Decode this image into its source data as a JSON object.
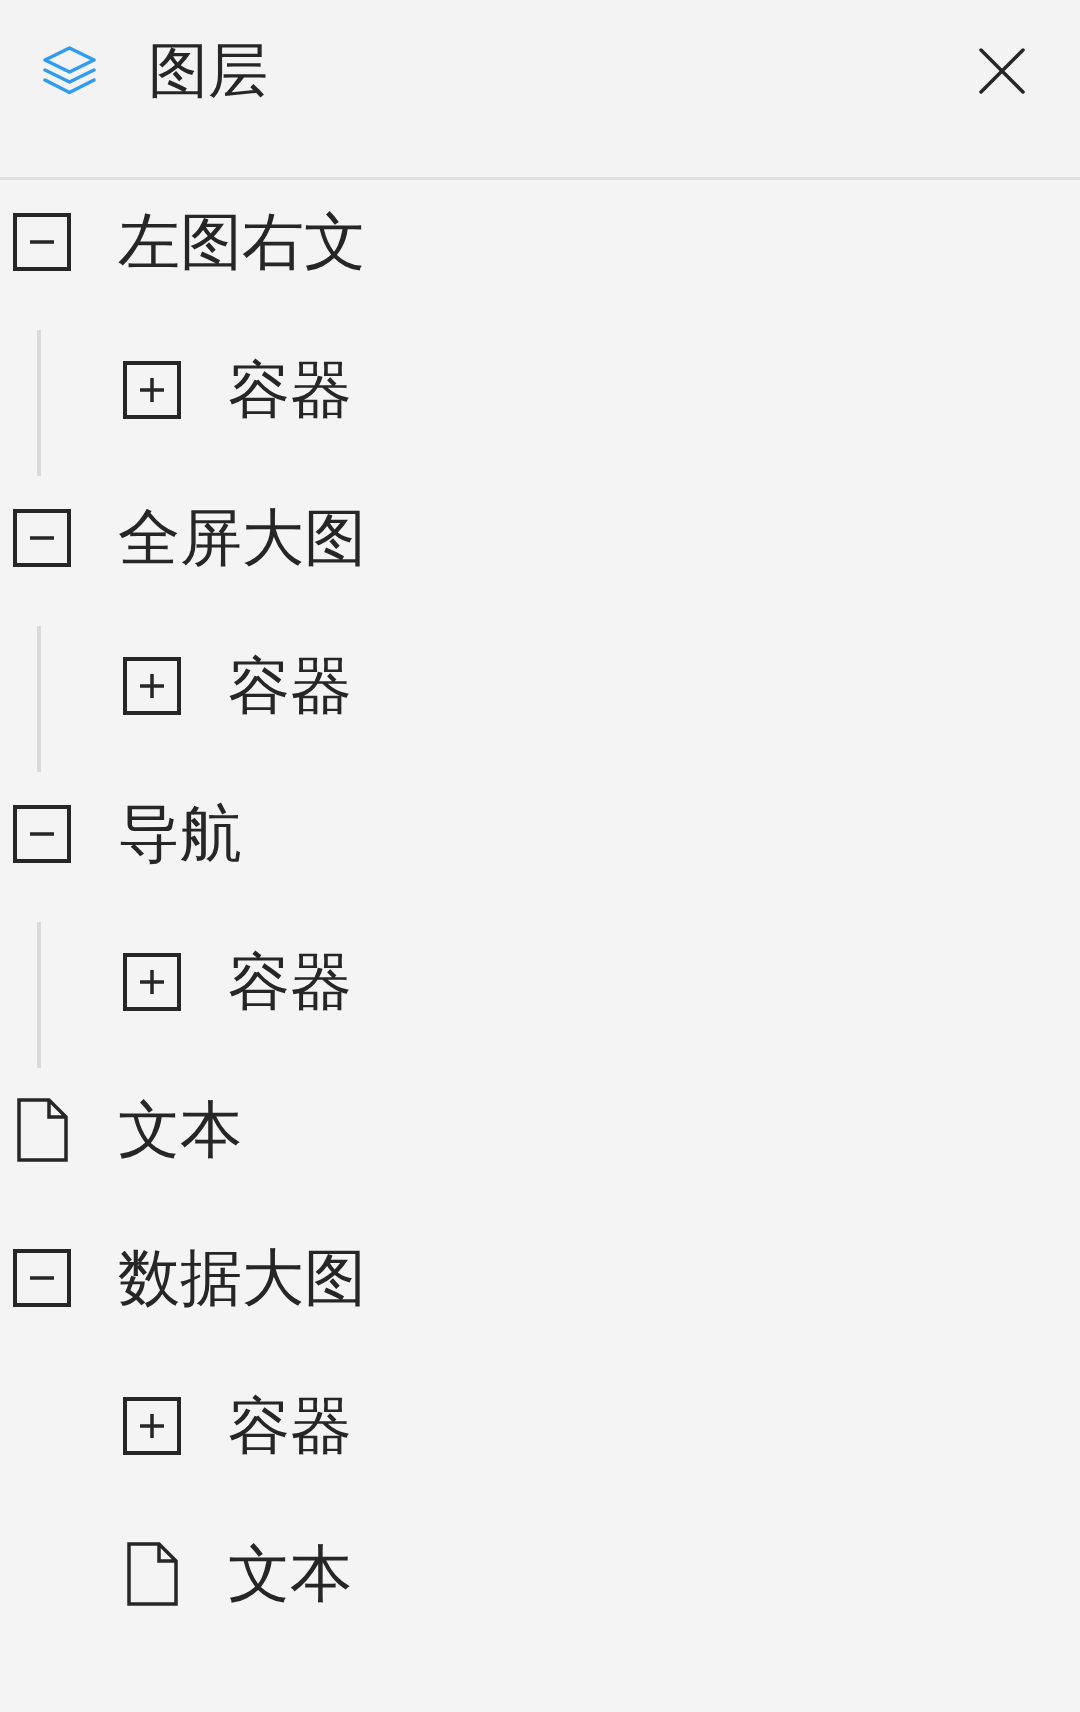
{
  "panel": {
    "title": "图层"
  },
  "layers": [
    {
      "kind": "group",
      "label": "左图右文",
      "expanded": true,
      "guide_line": true,
      "children": [
        {
          "kind": "group",
          "label": "容器",
          "expanded": false
        }
      ]
    },
    {
      "kind": "group",
      "label": "全屏大图",
      "expanded": true,
      "guide_line": true,
      "children": [
        {
          "kind": "group",
          "label": "容器",
          "expanded": false
        }
      ]
    },
    {
      "kind": "group",
      "label": "导航",
      "expanded": true,
      "guide_line": true,
      "children": [
        {
          "kind": "group",
          "label": "容器",
          "expanded": false
        }
      ]
    },
    {
      "kind": "file",
      "label": "文本"
    },
    {
      "kind": "group",
      "label": "数据大图",
      "expanded": true,
      "guide_line": false,
      "children": [
        {
          "kind": "group",
          "label": "容器",
          "expanded": false
        },
        {
          "kind": "file",
          "label": "文本"
        }
      ]
    }
  ]
}
